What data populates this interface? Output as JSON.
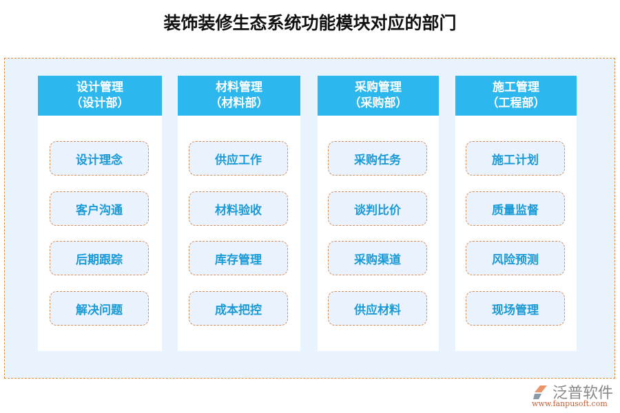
{
  "title": "装饰装修生态系统功能模块对应的部门",
  "columns": [
    {
      "name": "设计管理",
      "dept": "（设计部）",
      "items": [
        "设计理念",
        "客户沟通",
        "后期跟踪",
        "解决问题"
      ]
    },
    {
      "name": "材料管理",
      "dept": "（材料部）",
      "items": [
        "供应工作",
        "材料验收",
        "库存管理",
        "成本把控"
      ]
    },
    {
      "name": "采购管理",
      "dept": "（采购部）",
      "items": [
        "采购任务",
        "谈判比价",
        "采购渠道",
        "供应材料"
      ]
    },
    {
      "name": "施工管理",
      "dept": "（工程部）",
      "items": [
        "施工计划",
        "质量监督",
        "风险预测",
        "现场管理"
      ]
    }
  ],
  "logo": {
    "name": "泛普软件",
    "url": "www.fanpusoft.com"
  },
  "colors": {
    "header": "#2cb8ee",
    "border": "#e08a3c",
    "text": "#1a9ad6"
  }
}
